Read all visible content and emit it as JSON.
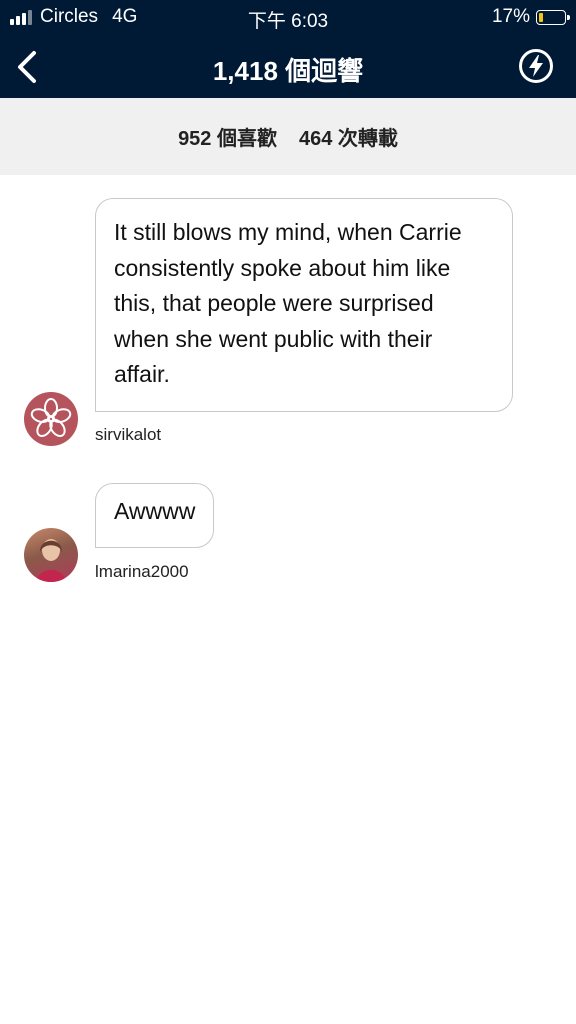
{
  "status_bar": {
    "carrier": "Circles",
    "network": "4G",
    "time": "下午 6:03",
    "battery_percent": "17%",
    "battery_level": 0.17
  },
  "nav": {
    "title": "1,418 個迴響",
    "back_icon": "chevron-left-icon",
    "action_icon": "lightning-bolt-icon"
  },
  "stats": {
    "likes": "952 個喜歡",
    "reblogs": "464 次轉載"
  },
  "notes": [
    {
      "text": "It still blows my mind, when Carrie consistently spoke about him like this, that people were surprised when she went public with their affair.",
      "username": "sirvikalot",
      "avatar_color": "#b5545c"
    },
    {
      "text": "Awwww",
      "username": "lmarina2000",
      "avatar_color": "#8a5a4a"
    }
  ],
  "colors": {
    "header_bg": "#001935",
    "stats_bg": "#f0f0f0",
    "battery_fill": "#f5c518"
  }
}
